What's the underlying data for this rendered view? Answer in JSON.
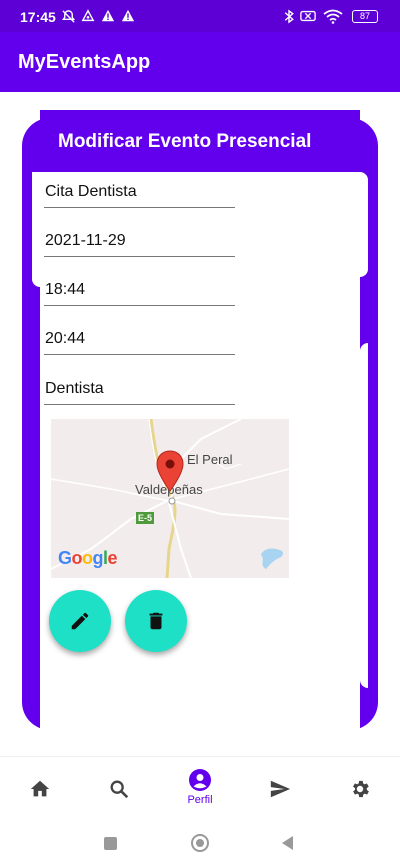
{
  "status_bar": {
    "time": "17:45",
    "battery": "87"
  },
  "app_bar": {
    "title": "MyEventsApp"
  },
  "card": {
    "title": "Modificar Evento Presencial",
    "fields": {
      "name": "Cita Dentista",
      "date": "2021-11-29",
      "start_time": "18:44",
      "end_time": "20:44",
      "description": "Dentista"
    }
  },
  "map": {
    "labels": {
      "town1": "El Peral",
      "town2": "Valdepeñas",
      "road": "E-5"
    },
    "logo": "Google"
  },
  "actions": {
    "edit_icon": "pencil-icon",
    "delete_icon": "trash-icon"
  },
  "bottom_nav": {
    "items": [
      {
        "icon": "home-icon",
        "label": ""
      },
      {
        "icon": "search-icon",
        "label": ""
      },
      {
        "icon": "profile-icon",
        "label": "Perfil"
      },
      {
        "icon": "send-icon",
        "label": ""
      },
      {
        "icon": "settings-icon",
        "label": ""
      }
    ]
  },
  "colors": {
    "primary": "#6200ee",
    "status_bar": "#5c00d6",
    "fab": "#1de0c6"
  }
}
